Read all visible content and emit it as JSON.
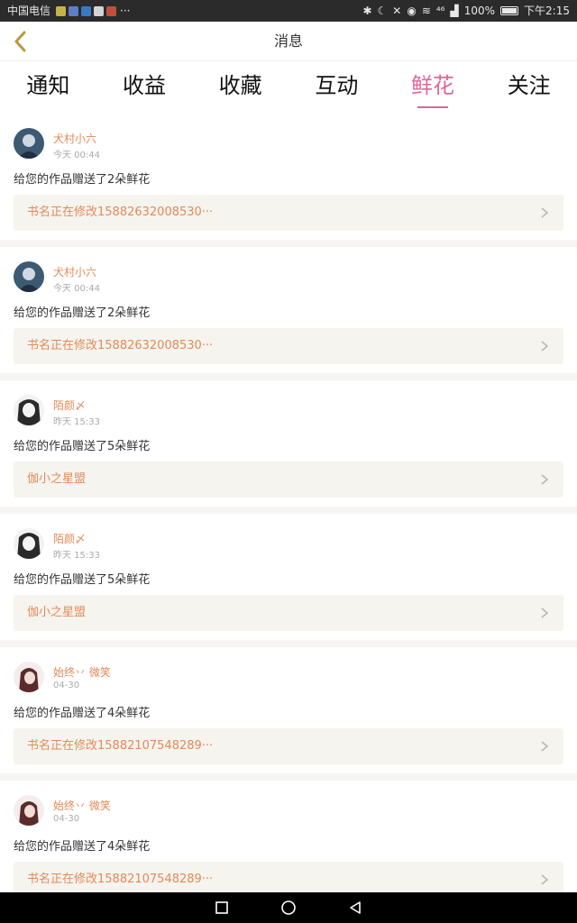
{
  "status_bar": {
    "carrier": "中国电信",
    "more": "···",
    "signal_text": "⁴⁶",
    "battery": "100%",
    "time": "下午2:15"
  },
  "header": {
    "title": "消息",
    "back_icon": "chevron-left-icon"
  },
  "tabs": [
    {
      "label": "通知",
      "active": false
    },
    {
      "label": "收益",
      "active": false
    },
    {
      "label": "收藏",
      "active": false
    },
    {
      "label": "互动",
      "active": false
    },
    {
      "label": "鲜花",
      "active": true
    },
    {
      "label": "关注",
      "active": false
    }
  ],
  "colors": {
    "accent": "#e0659b",
    "name": "#e28a5a",
    "book_bg": "#f6f4ee"
  },
  "messages": [
    {
      "user": "犬村小六",
      "time": "今天 00:44",
      "text": "给您的作品赠送了2朵鲜花",
      "book": "书名正在修改15882632008530···"
    },
    {
      "user": "犬村小六",
      "time": "今天 00:44",
      "text": "给您的作品赠送了2朵鲜花",
      "book": "书名正在修改15882632008530···"
    },
    {
      "user": "陌颜〆",
      "time": "昨天 15:33",
      "text": "给您的作品赠送了5朵鲜花",
      "book": "伽小之星盟"
    },
    {
      "user": "陌颜〆",
      "time": "昨天 15:33",
      "text": "给您的作品赠送了5朵鲜花",
      "book": "伽小之星盟"
    },
    {
      "user": "始终丷 微笑",
      "time": "04-30",
      "text": "给您的作品赠送了4朵鲜花",
      "book": "书名正在修改15882107548289···"
    },
    {
      "user": "始终丷 微笑",
      "time": "04-30",
      "text": "给您的作品赠送了4朵鲜花",
      "book": "书名正在修改15882107548289···"
    }
  ],
  "navbar": [
    "back-triangle-icon",
    "home-circle-icon",
    "recent-square-icon"
  ]
}
